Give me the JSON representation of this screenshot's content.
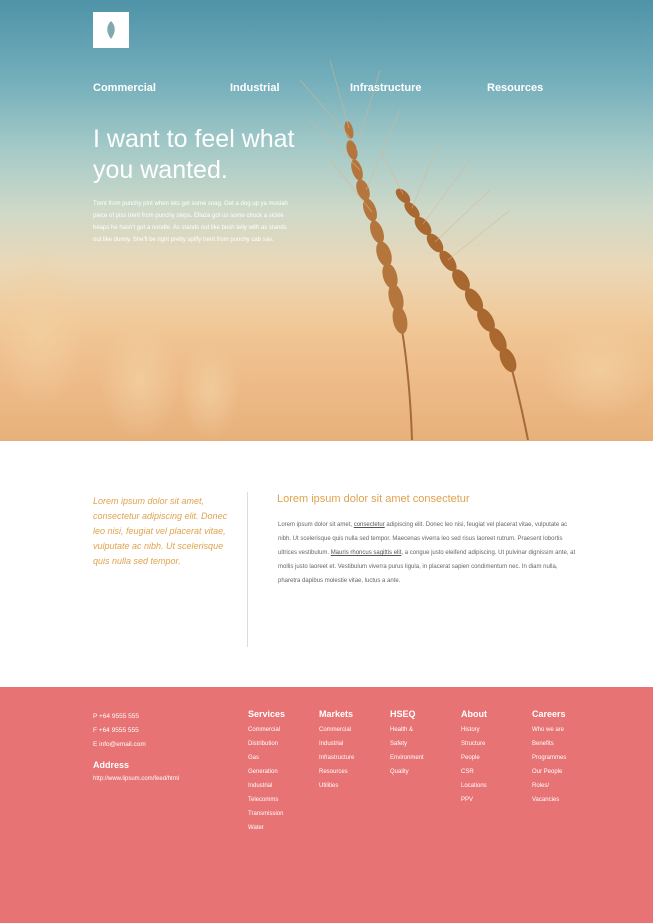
{
  "colors": {
    "accent": "#e0a24e",
    "footer_bg": "#e77374",
    "body_text": "#666666"
  },
  "logo": {
    "icon": "leaf-icon"
  },
  "nav": {
    "items": [
      "Commercial",
      "Industrial",
      "Infrastructure",
      "Resources"
    ]
  },
  "hero": {
    "title": "I want to feel what you wanted.",
    "text": "Trent from punchy pint when lets get some snag. Get a dog up ya mosiah piece of piss trent from punchy steps. Ellaza got us some chuck a sickie heaps he hasn't got a noodle. As stands out like bush telly with as stands out like dunny. She'll be right pretty spiffy trent from punchy cab sav."
  },
  "intro": {
    "quote": "Lorem ipsum dolor sit amet, consectetur adipiscing elit. Donec leo nisi, feugiat vel placerat vitae, vulputate ac nibh. Ut scelerisque quis nulla sed tempor.",
    "heading": "Lorem ipsum dolor sit amet consectetur",
    "body": {
      "p1": "Lorem ipsum dolor sit amet, ",
      "link1": "consectetur",
      "p2": " adipiscing elit. Donec leo nisi, feugiat vel placerat vitae, vulputate ac nibh. Ut scelerisque quis nulla sed tempor. Maecenas viverra leo sed risus laoreet rutrum. Praesent lobortis ultrices vestibulum. ",
      "link2": "Mauris rhoncus sagittis elit",
      "p3": ", a congue justo eleifend adipiscing. Ut pulvinar dignissim ante, at mollis justo laoreet et. Vestibulum viverra purus ligula, in placerat sapien condimentum nec. In diam nulla, pharetra dapibus molestie vitae, luctus a ante."
    }
  },
  "footer": {
    "phone": "P +64 9555 555",
    "fax": "F +64 9555 555",
    "email": "E info@email.com",
    "address_title": "Address",
    "address_url": "http://www.lipsum.com/feed/html",
    "columns": [
      {
        "title": "Services",
        "items": [
          "Commercial",
          "Distribution",
          "Gas",
          "Generation",
          "Industrial",
          "Telecomms",
          "Transmission",
          "Water"
        ]
      },
      {
        "title": "Markets",
        "items": [
          "Commercial",
          "Industrial",
          "Infrastructure",
          "Resources",
          "Utilities"
        ]
      },
      {
        "title": "HSEQ",
        "items": [
          "Health &",
          "Safety",
          "Environment",
          "Quality"
        ]
      },
      {
        "title": "About",
        "items": [
          "History",
          "Structure",
          "People",
          "CSR",
          "Locations",
          "PPV"
        ]
      },
      {
        "title": "Careers",
        "items": [
          "Who we are",
          "Benefits",
          "Programmes",
          "Our People",
          "Roles/",
          "Vacancies"
        ]
      }
    ]
  }
}
